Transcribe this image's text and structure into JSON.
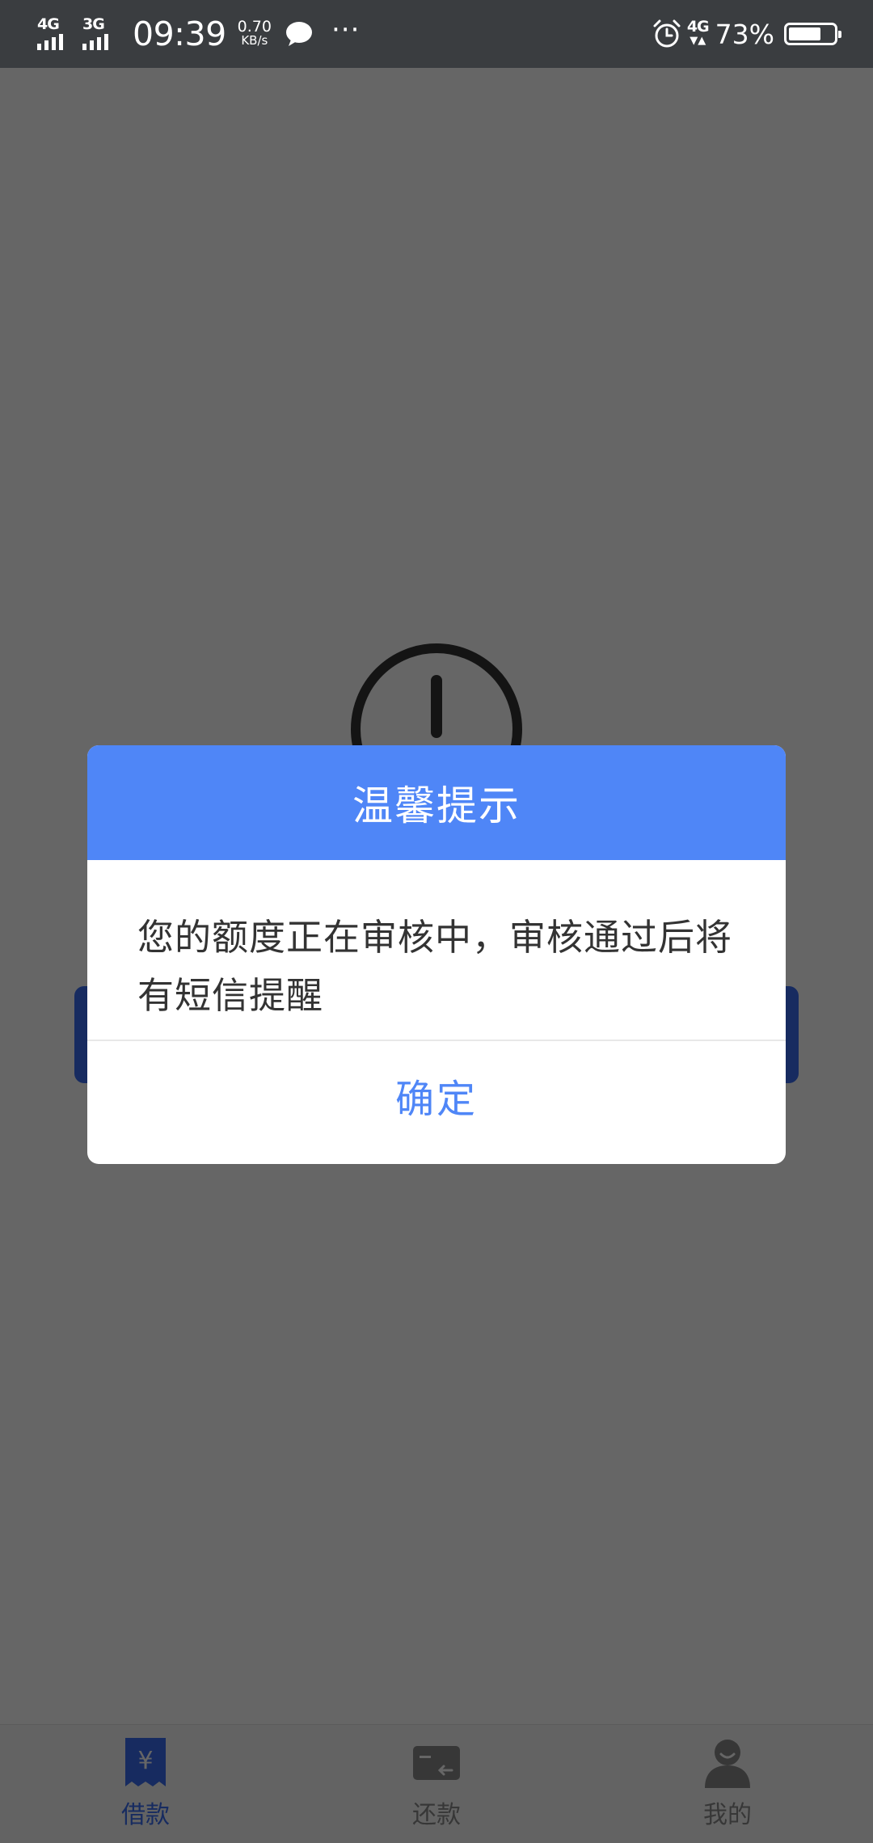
{
  "status_bar": {
    "net1": "4G",
    "net2": "3G",
    "time": "09:39",
    "speed_value": "0.70",
    "speed_unit": "KB/s",
    "more": "···",
    "net_right": "4G",
    "net_right_arrows": "▼▲",
    "battery_percent": "73%",
    "battery_level": 0.73,
    "icons": [
      "chat-bubble-icon",
      "alarm-icon"
    ]
  },
  "tabs": [
    {
      "label": "借款",
      "icon": "loan-receipt-icon",
      "active": true
    },
    {
      "label": "还款",
      "icon": "card-repay-icon",
      "active": false
    },
    {
      "label": "我的",
      "icon": "user-icon",
      "active": false
    }
  ],
  "dialog": {
    "title": "温馨提示",
    "message": "您的额度正在审核中，审核通过后将有短信提醒",
    "confirm_label": "确定"
  },
  "colors": {
    "accent": "#4f86f7",
    "tab_active": "#3a6df0",
    "status_bar": "#3a3d40"
  }
}
